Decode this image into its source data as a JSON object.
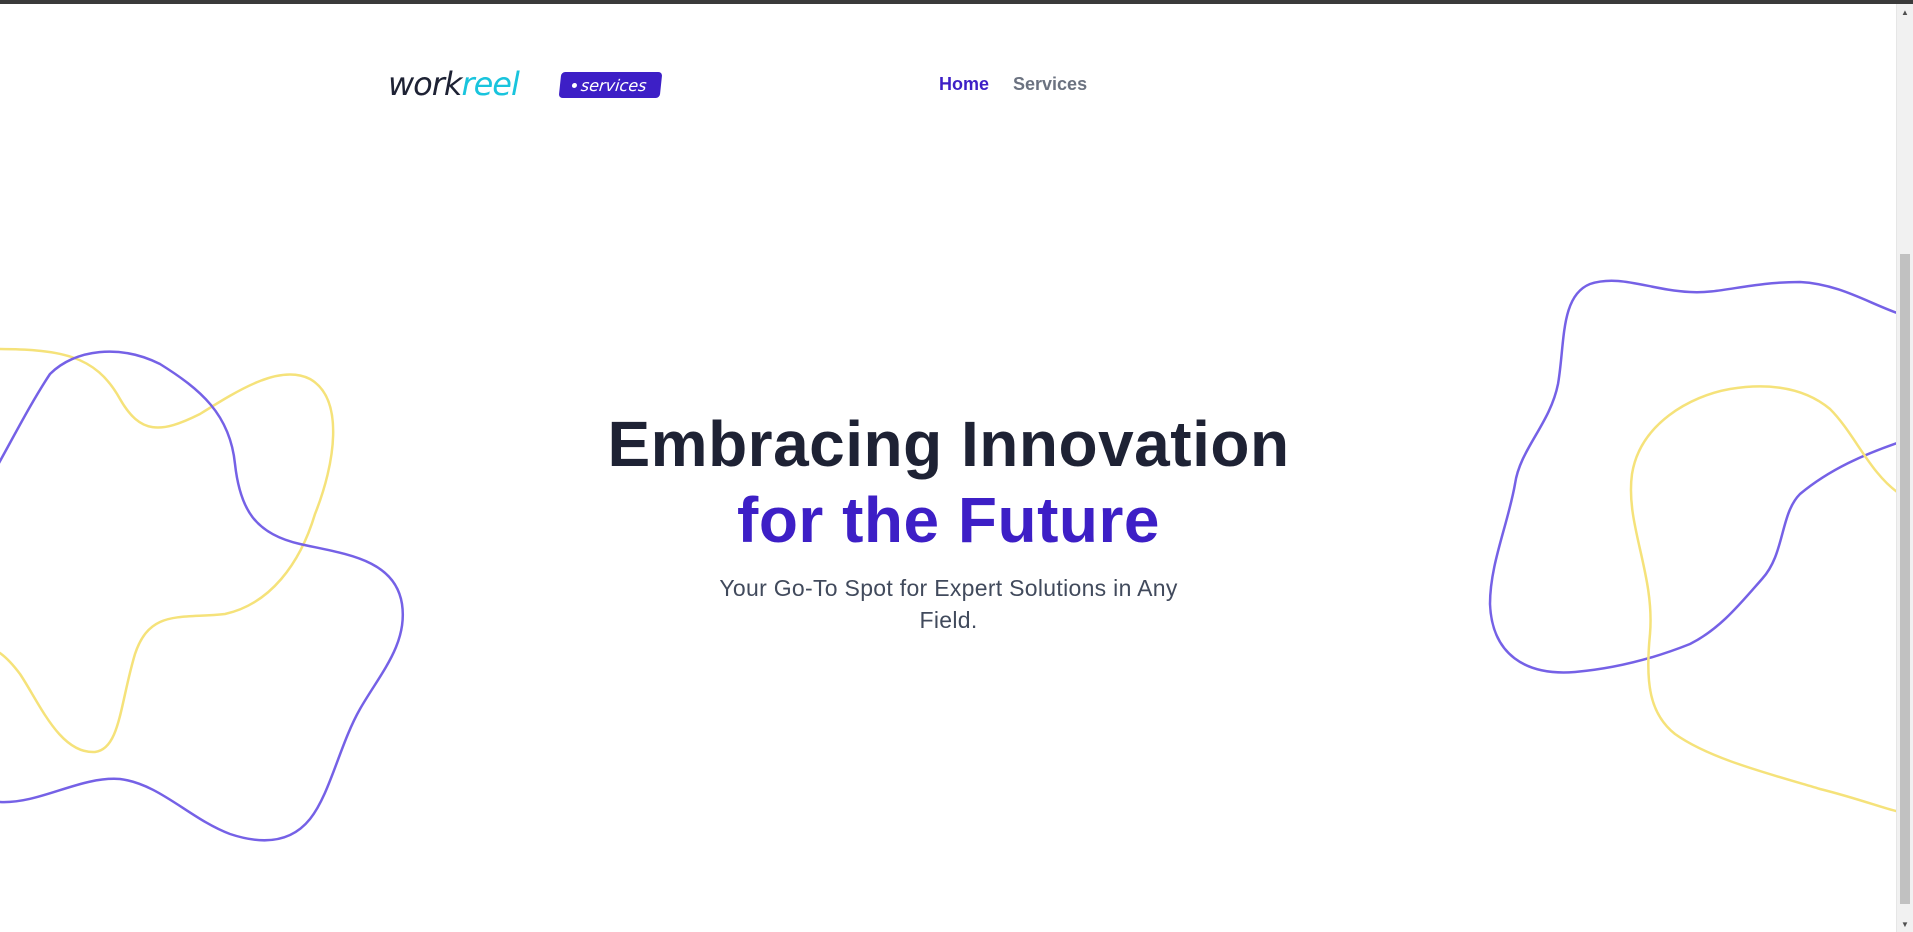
{
  "brand": {
    "logo_part1": "work",
    "logo_part2": "reel",
    "badge": "services"
  },
  "nav": {
    "items": [
      {
        "label": "Home",
        "active": true
      },
      {
        "label": "Services",
        "active": false
      }
    ]
  },
  "hero": {
    "title_line1": "Embracing Innovation",
    "title_line2": "for the Future",
    "subtitle": "Your Go-To Spot for Expert Solutions in Any Field."
  },
  "colors": {
    "primary": "#3d1fc6",
    "accent_cyan": "#19c4dd",
    "text_dark": "#1e2234",
    "blob_purple": "#7561e6",
    "blob_yellow": "#f5e27a"
  }
}
